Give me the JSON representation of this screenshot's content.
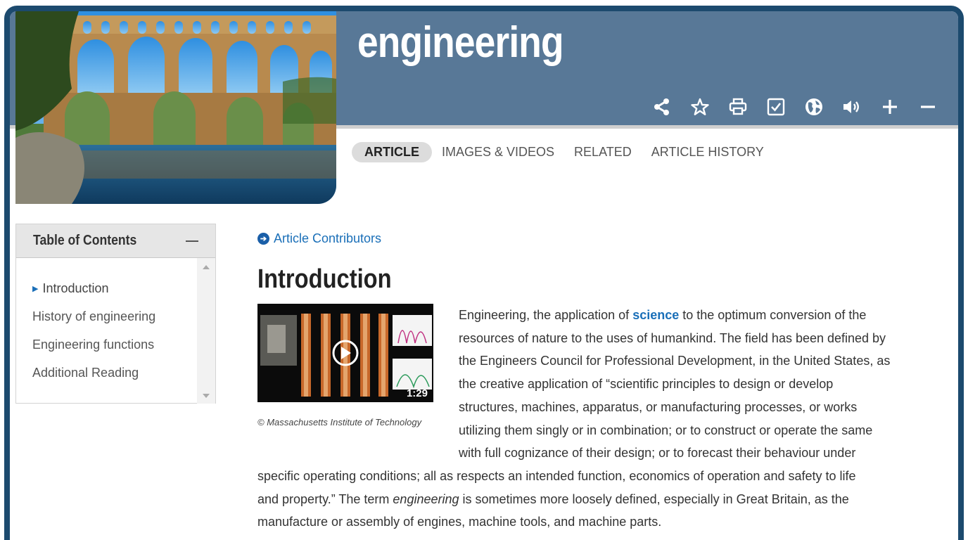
{
  "header": {
    "title": "engineering",
    "toolbar": [
      {
        "name": "share-icon"
      },
      {
        "name": "star-icon"
      },
      {
        "name": "print-icon"
      },
      {
        "name": "checkbox-icon"
      },
      {
        "name": "globe-icon"
      },
      {
        "name": "speaker-icon"
      },
      {
        "name": "plus-icon"
      },
      {
        "name": "minus-icon"
      }
    ]
  },
  "tabs": [
    {
      "label": "ARTICLE",
      "active": true
    },
    {
      "label": "IMAGES & VIDEOS"
    },
    {
      "label": "RELATED"
    },
    {
      "label": "ARTICLE HISTORY"
    }
  ],
  "toc": {
    "title": "Table of Contents",
    "items": [
      {
        "label": "Introduction",
        "current": true
      },
      {
        "label": "History of engineering"
      },
      {
        "label": "Engineering functions"
      },
      {
        "label": "Additional Reading"
      }
    ]
  },
  "article": {
    "contributors_link": "Article Contributors",
    "section_title": "Introduction",
    "video": {
      "duration": "1:29",
      "caption": "© Massachusetts Institute of Technology"
    },
    "para_lines": [
      {
        "pre": "Engineering, the application of ",
        "link": "science",
        "post": " to the optimum conversion of the"
      },
      {
        "text": "resources of nature to the uses of humankind. The field has been defined by"
      },
      {
        "text": "the Engineers Council for Professional Development, in the United States, as"
      },
      {
        "text": "the creative application of “scientific principles to design or develop"
      },
      {
        "text": "structures, machines, apparatus, or manufacturing processes, or works"
      },
      {
        "text": "utilizing them singly or in combination; or to construct or operate the same"
      },
      {
        "text": "with full cognizance of their design; or to forecast their behaviour under"
      }
    ],
    "full_lines": [
      {
        "text": "specific operating conditions; all as respects an intended function, economics of operation and safety to life"
      },
      {
        "pre": "and property.” The term ",
        "em": "engineering",
        "post": " is sometimes more loosely defined, especially in Great Britain, as the"
      },
      {
        "text": "manufacture or assembly of engines, machine tools, and machine parts."
      }
    ]
  },
  "colors": {
    "header_band": "#587897",
    "frame": "#1c4a6e",
    "link": "#1a6fb8"
  }
}
